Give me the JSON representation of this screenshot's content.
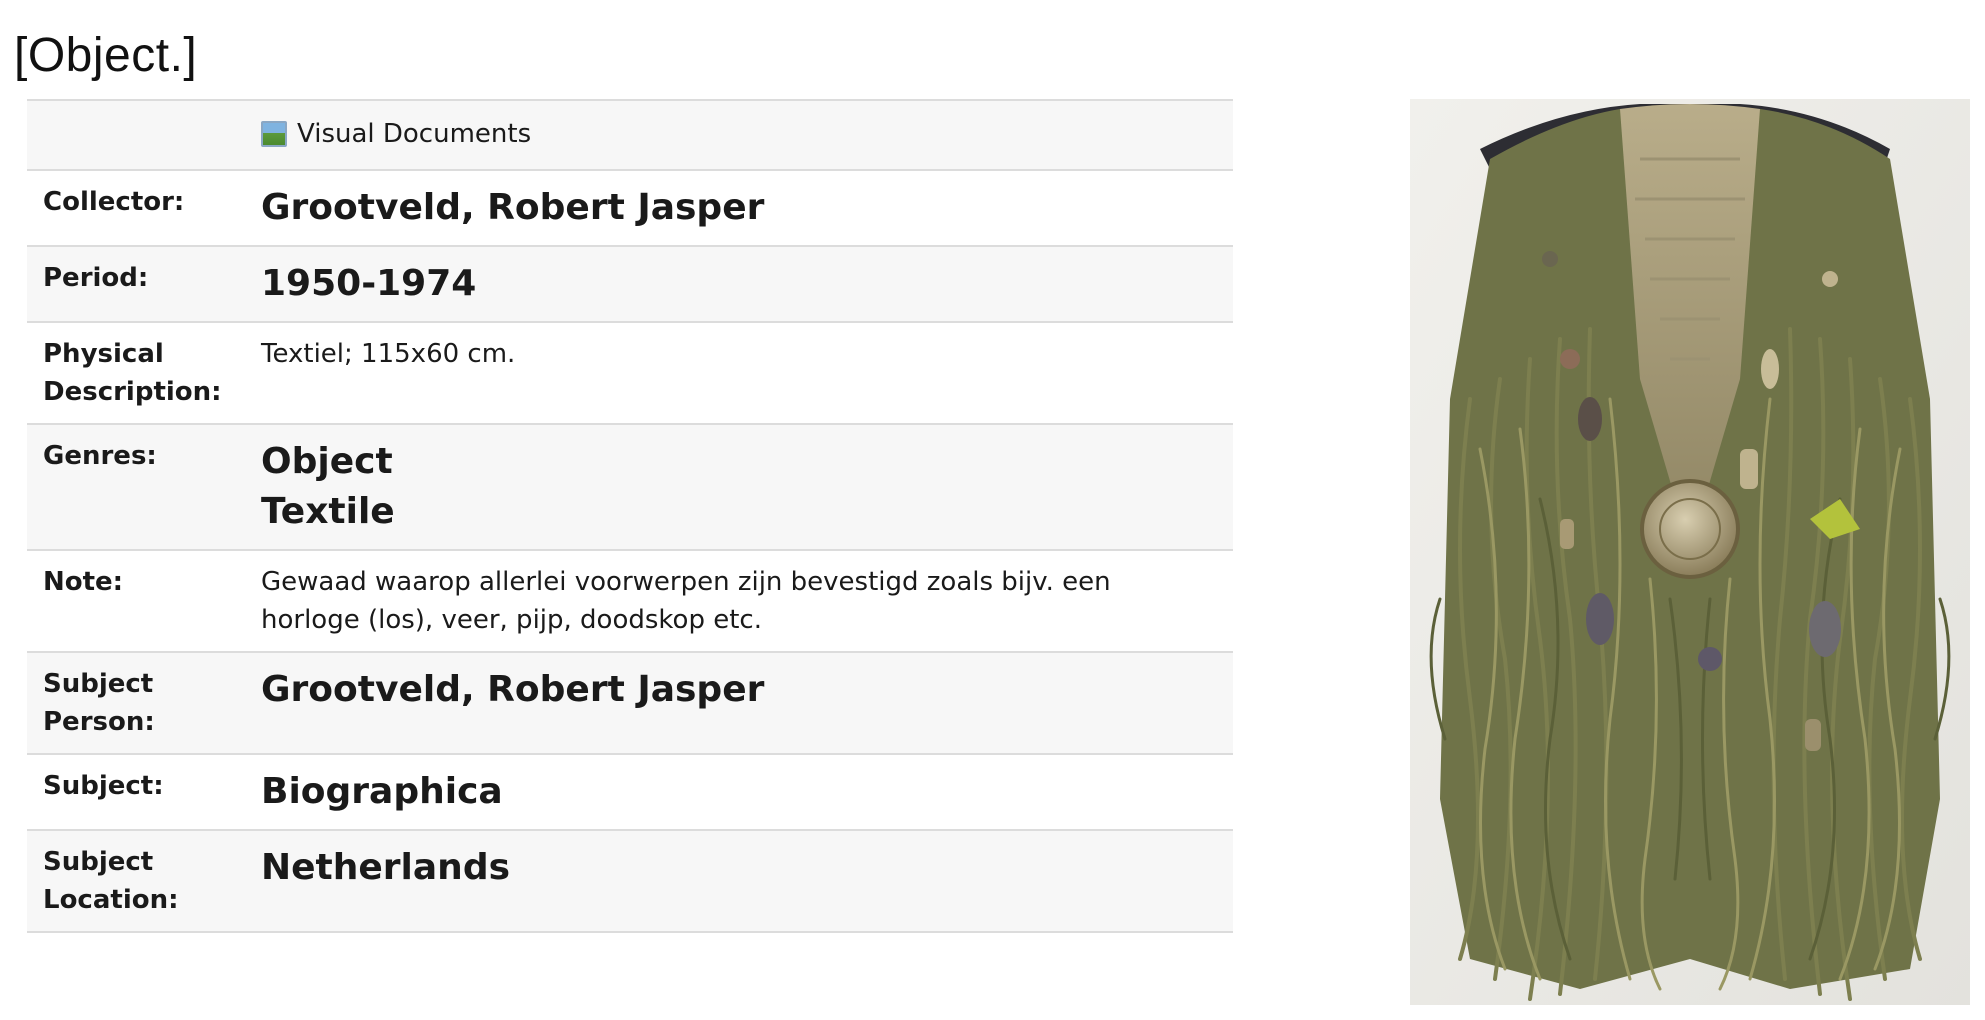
{
  "page": {
    "title": "[Object.]"
  },
  "visual_documents_label": "Visual Documents",
  "record": {
    "collector_label": "Collector:",
    "collector_value": "Grootveld, Robert Jasper",
    "period_label": "Period:",
    "period_value": "1950-1974",
    "physical_label_1": "Physical",
    "physical_label_2": "Description:",
    "physical_value": "Textiel; 115x60 cm.",
    "genres_label": "Genres:",
    "genres": [
      "Object",
      "Textile"
    ],
    "note_label": "Note:",
    "note_line_1": "Gewaad waarop allerlei voorwerpen zijn bevestigd zoals bijv. een",
    "note_line_2": "horloge (los), veer, pijp, doodskop etc.",
    "subject_person_label_1": "Subject",
    "subject_person_label_2": "Person:",
    "subject_person_value": "Grootveld, Robert Jasper",
    "subject_label": "Subject:",
    "subject_value": "Biographica",
    "subject_location_label_1": "Subject",
    "subject_location_label_2": "Location:",
    "subject_location_value": "Netherlands"
  },
  "icons": {
    "visual_documents": "image-icon"
  },
  "colors": {
    "row_shaded": "#f7f7f7",
    "row_border": "#dcdcdc",
    "text": "#1a1a1a"
  }
}
